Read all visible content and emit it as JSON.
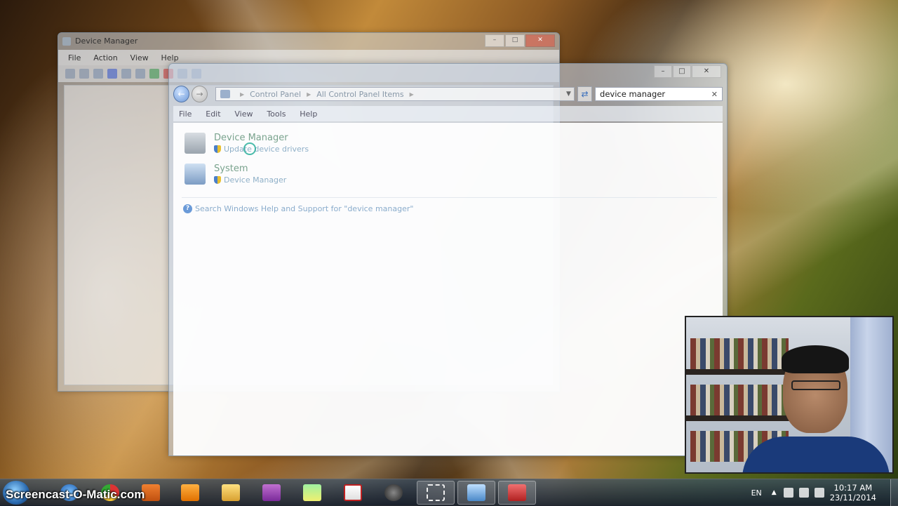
{
  "back_window": {
    "title": "Device Manager",
    "menu": [
      "File",
      "Action",
      "View",
      "Help"
    ]
  },
  "front_window": {
    "address_crumbs": [
      "Control Panel",
      "All Control Panel Items"
    ],
    "search": {
      "value": "device manager"
    },
    "menu": [
      "File",
      "Edit",
      "View",
      "Tools",
      "Help"
    ],
    "results": [
      {
        "title": "Device Manager",
        "subtitle": "Update device drivers"
      },
      {
        "title": "System",
        "subtitle": "Device Manager"
      }
    ],
    "help_link": "Search Windows Help and Support for \"device manager\""
  },
  "taskbar": {
    "watermark": "Screencast-O-Matic.com",
    "language": "EN",
    "time": "10:17 AM",
    "date": "23/11/2014"
  },
  "colors": {
    "taskbar_bg": "#1e2a3a",
    "link_green": "#7aa38e",
    "link_blue": "#8fb0c8"
  }
}
